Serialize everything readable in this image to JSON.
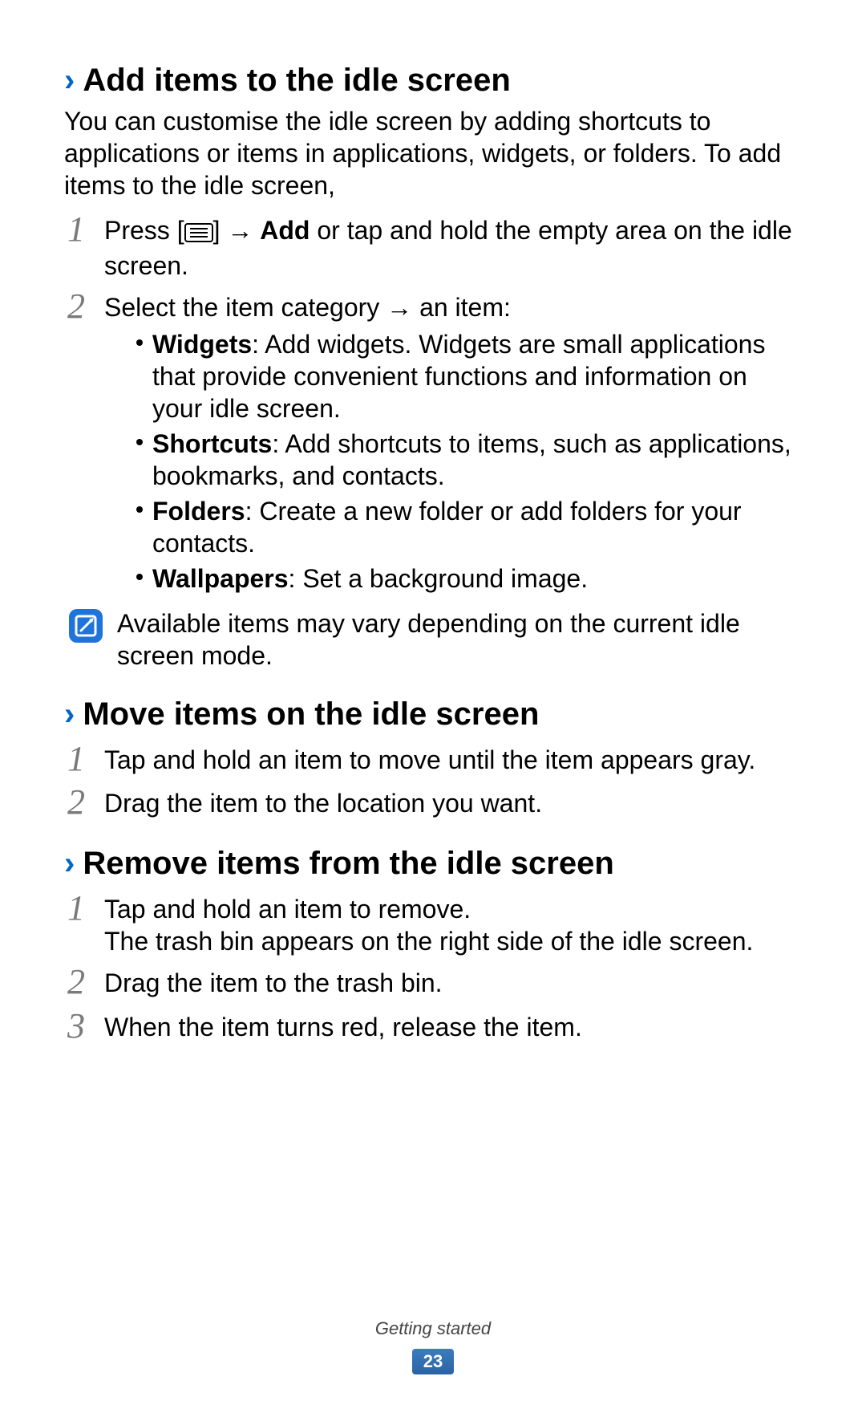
{
  "sections": {
    "add": {
      "title": "Add items to the idle screen",
      "intro": "You can customise the idle screen by adding shortcuts to applications or items in applications, widgets, or folders. To add items to the idle screen,",
      "step1_pre": "Press [",
      "step1_mid": "] → ",
      "step1_bold": "Add",
      "step1_post": " or tap and hold the empty area on the idle screen.",
      "step2": "Select the item category → an item:",
      "bullets": {
        "widgets_b": "Widgets",
        "widgets_t": ": Add widgets. Widgets are small applications that provide convenient functions and information on your idle screen.",
        "shortcuts_b": "Shortcuts",
        "shortcuts_t": ": Add shortcuts to items, such as applications, bookmarks, and contacts.",
        "folders_b": "Folders",
        "folders_t": ": Create a new folder or add folders for your contacts.",
        "wallpapers_b": "Wallpapers",
        "wallpapers_t": ": Set a background image."
      },
      "note": "Available items may vary depending on the current idle screen mode."
    },
    "move": {
      "title": "Move items on the idle screen",
      "step1": "Tap and hold an item to move until the item appears gray.",
      "step2": "Drag the item to the location you want."
    },
    "remove": {
      "title": "Remove items from the idle screen",
      "step1a": "Tap and hold an item to remove.",
      "step1b": "The trash bin appears on the right side of the idle screen.",
      "step2": "Drag the item to the trash bin.",
      "step3": "When the item turns red, release the item."
    }
  },
  "nums": {
    "n1": "1",
    "n2": "2",
    "n3": "3"
  },
  "chevron": "›",
  "footer": {
    "chapter": "Getting started",
    "page": "23"
  }
}
